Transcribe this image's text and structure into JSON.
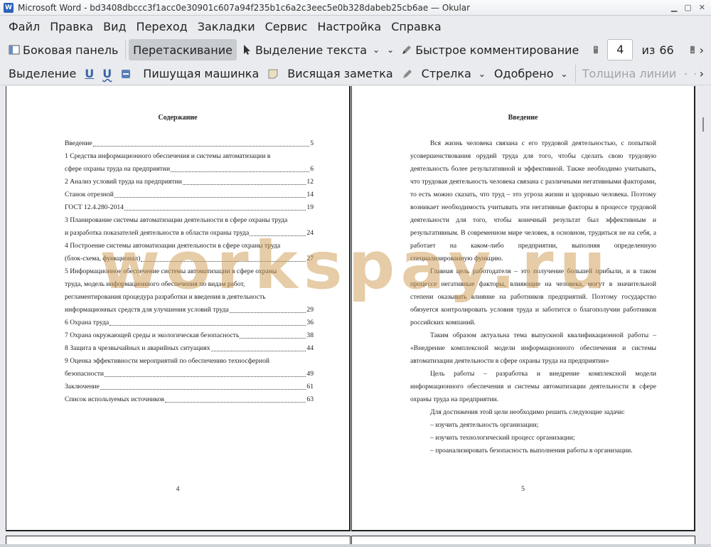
{
  "window": {
    "title": "Microsoft Word - bd3408dbccc3f1acc0e30901c607a94f235b1c6a2c3eec5e0b328dabeb25cb6ae  — Okular"
  },
  "menu": [
    "Файл",
    "Правка",
    "Вид",
    "Переход",
    "Закладки",
    "Сервис",
    "Настройка",
    "Справка"
  ],
  "toolbar": {
    "sidebar_label": "Боковая панель",
    "drag_label": "Перетаскивание",
    "text_select_label": "Выделение текста",
    "quick_comment_label": "Быстрое комментирование",
    "page_value": "4",
    "of_label": "из",
    "page_total": "66"
  },
  "annot_toolbar": {
    "highlight_label": "Выделение",
    "typewriter_label": "Пишущая машинка",
    "note_label": "Висящая заметка",
    "arrow_label": "Стрелка",
    "stamp_label": "Одобрено",
    "line_width_label": "Толщина линии"
  },
  "left_page": {
    "heading": "Содержание",
    "toc": [
      {
        "lines": [],
        "last": "Введение",
        "page": "5"
      },
      {
        "lines": [
          "1 Средства информационного обеспечения и системы автоматизации в"
        ],
        "last": "сфере охраны труда на предприятии",
        "page": "6"
      },
      {
        "lines": [],
        "last": "2 Анализ условий труда на предприятии",
        "page": "12"
      },
      {
        "lines": [],
        "last": "Станок отрезной",
        "page": "14"
      },
      {
        "lines": [],
        "last": "ГОСТ 12.4.280-2014",
        "page": "19"
      },
      {
        "lines": [
          "3 Планирование системы автоматизации деятельности в сфере охраны труда"
        ],
        "last": "и разработка показателей деятельности в области охраны труда",
        "page": "24"
      },
      {
        "lines": [
          "4 Построение системы автоматизации деятельности в сфере охраны труда"
        ],
        "last": "(блок-схема, функционал)",
        "page": "27"
      },
      {
        "lines": [
          "5 Информационное обеспечение системы автоматизации в сфере охраны",
          "труда, модель информационного обеспечения по видам работ,",
          "регламентирования процедура разработки и введения в деятельность"
        ],
        "last": "информационных средств для улучшения условий труда",
        "page": "29"
      },
      {
        "lines": [],
        "last": "6 Охрана труда",
        "page": "36"
      },
      {
        "lines": [],
        "last": "7 Охрана окружающей среды и экологическая безопасность",
        "page": "38"
      },
      {
        "lines": [],
        "last": "8 Защита в чрезвычайных и аварийных ситуациях",
        "page": "44"
      },
      {
        "lines": [
          "9 Оценка эффективности мероприятий по обеспечению техносферной"
        ],
        "last": "безопасности",
        "page": "49"
      },
      {
        "lines": [],
        "last": "Заключение",
        "page": "61"
      },
      {
        "lines": [],
        "last": "Список используемых источников",
        "page": "63"
      }
    ],
    "page_number": "4"
  },
  "right_page": {
    "heading": "Введение",
    "paragraphs": [
      "Вся жизнь человека связана с его трудовой деятельностью, с попыткой усовершенствования орудий труда для того, чтобы сделать свою трудовую деятельность более результативной и эффективной. Также необходимо учитывать, что трудовая деятельность человека связана с различными негативными факторами, то есть можно сказать, что труд – это угроза жизни и здоровью человека. Поэтому возникает необходимость учитывать эти негативные факторы в процессе трудовой деятельности для того, чтобы конечный результат был эффективным и результативным. В современном мире человек, в основном, трудиться не на себя, а работает на каком-либо предприятии, выполняя определенную специализированную функцию.",
      "Главная цель работодателя – это получение большей прибыли, и в таком процессе негативные факторы, влияющие на человека, могут в значительной степени оказывать влияние на работников предприятий. Поэтому государство обязуется контролировать условия труда и заботится о благополучии работников российских компаний.",
      "Таким образом актуальна тема выпускной квалификационной работы – «Внедрение комплексной модели информационного обеспечения и системы автоматизации деятельности в сфере охраны труда на предприятии»",
      "Цель работы – разработка  и внедрение комплексной модели информационного обеспечения и системы автоматизации деятельности в сфере охраны труда на предприятии.",
      "Для достижения этой цели необходимо решить следующие задачи:"
    ],
    "list": [
      "–  изучить деятельность организации;",
      "–  изучить технологический процесс организации;",
      "–  проанализировать безопасность выполнения работы в организации."
    ],
    "page_number": "5"
  },
  "watermark": "workspay.ru"
}
